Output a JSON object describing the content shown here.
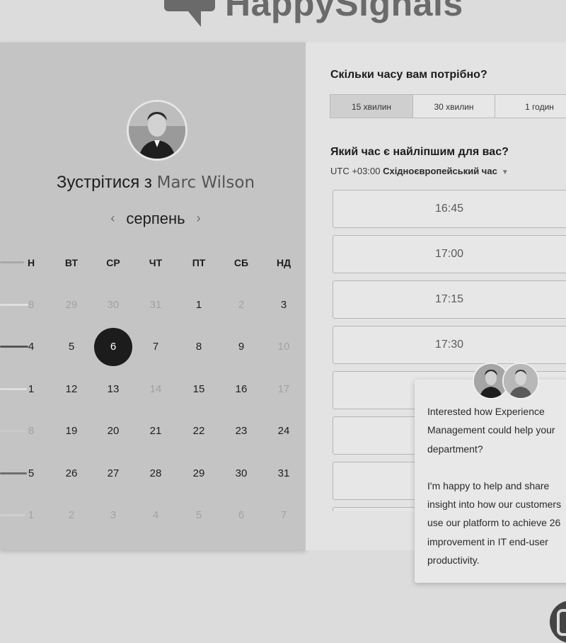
{
  "brand": {
    "name": "HappySignals"
  },
  "calendar": {
    "meet_prefix": "Зустрітися з",
    "host_name": "Marc Wilson",
    "month": "серпень",
    "prev_month_icon": "‹",
    "next_month_icon": "›",
    "weekday_headers": [
      "Н",
      "ВТ",
      "СР",
      "ЧТ",
      "ПТ",
      "СБ",
      "НД"
    ],
    "weeks": [
      [
        {
          "d": "8",
          "s": "muted"
        },
        {
          "d": "29",
          "s": "muted"
        },
        {
          "d": "30",
          "s": "muted"
        },
        {
          "d": "31",
          "s": "muted"
        },
        {
          "d": "1",
          "s": "active"
        },
        {
          "d": "2",
          "s": "muted"
        },
        {
          "d": "3",
          "s": "active"
        }
      ],
      [
        {
          "d": "4",
          "s": "active"
        },
        {
          "d": "5",
          "s": "active"
        },
        {
          "d": "6",
          "s": "selected"
        },
        {
          "d": "7",
          "s": "active"
        },
        {
          "d": "8",
          "s": "active"
        },
        {
          "d": "9",
          "s": "active"
        },
        {
          "d": "10",
          "s": "muted"
        }
      ],
      [
        {
          "d": "1",
          "s": "active"
        },
        {
          "d": "12",
          "s": "active"
        },
        {
          "d": "13",
          "s": "active"
        },
        {
          "d": "14",
          "s": "muted"
        },
        {
          "d": "15",
          "s": "active"
        },
        {
          "d": "16",
          "s": "active"
        },
        {
          "d": "17",
          "s": "muted"
        }
      ],
      [
        {
          "d": "8",
          "s": "muted"
        },
        {
          "d": "19",
          "s": "active"
        },
        {
          "d": "20",
          "s": "active"
        },
        {
          "d": "21",
          "s": "active"
        },
        {
          "d": "22",
          "s": "active"
        },
        {
          "d": "23",
          "s": "active"
        },
        {
          "d": "24",
          "s": "active"
        }
      ],
      [
        {
          "d": "5",
          "s": "active"
        },
        {
          "d": "26",
          "s": "active"
        },
        {
          "d": "27",
          "s": "active"
        },
        {
          "d": "28",
          "s": "active"
        },
        {
          "d": "29",
          "s": "active"
        },
        {
          "d": "30",
          "s": "active"
        },
        {
          "d": "31",
          "s": "active"
        }
      ],
      [
        {
          "d": "1",
          "s": "muted"
        },
        {
          "d": "2",
          "s": "muted"
        },
        {
          "d": "3",
          "s": "muted"
        },
        {
          "d": "4",
          "s": "muted"
        },
        {
          "d": "5",
          "s": "muted"
        },
        {
          "d": "6",
          "s": "muted"
        },
        {
          "d": "7",
          "s": "muted"
        }
      ]
    ]
  },
  "scheduler": {
    "duration_question": "Скільки часу вам потрібно?",
    "duration_options": [
      "15 хвилин",
      "30 хвилин",
      "1 годин"
    ],
    "selected_duration": "15 хвилин",
    "time_question": "Який час є найліпшим для вас?",
    "timezone_offset": "UTC +03:00",
    "timezone_name": "Східноєвропейський час",
    "time_slots": [
      "16:45",
      "17:00",
      "17:15",
      "17:30",
      "",
      "",
      "",
      ""
    ]
  },
  "chat": {
    "message_1": "Interested how Experience Management could help your department?",
    "message_2": "I'm happy to help and share insight into how our customers use our platform to achieve 26 improvement in IT end-user productivity."
  },
  "colors": {
    "selected_day": "#1c1c1c",
    "left_panel_bg": "#c4c4c4",
    "right_panel_bg": "#e3e3e3"
  }
}
